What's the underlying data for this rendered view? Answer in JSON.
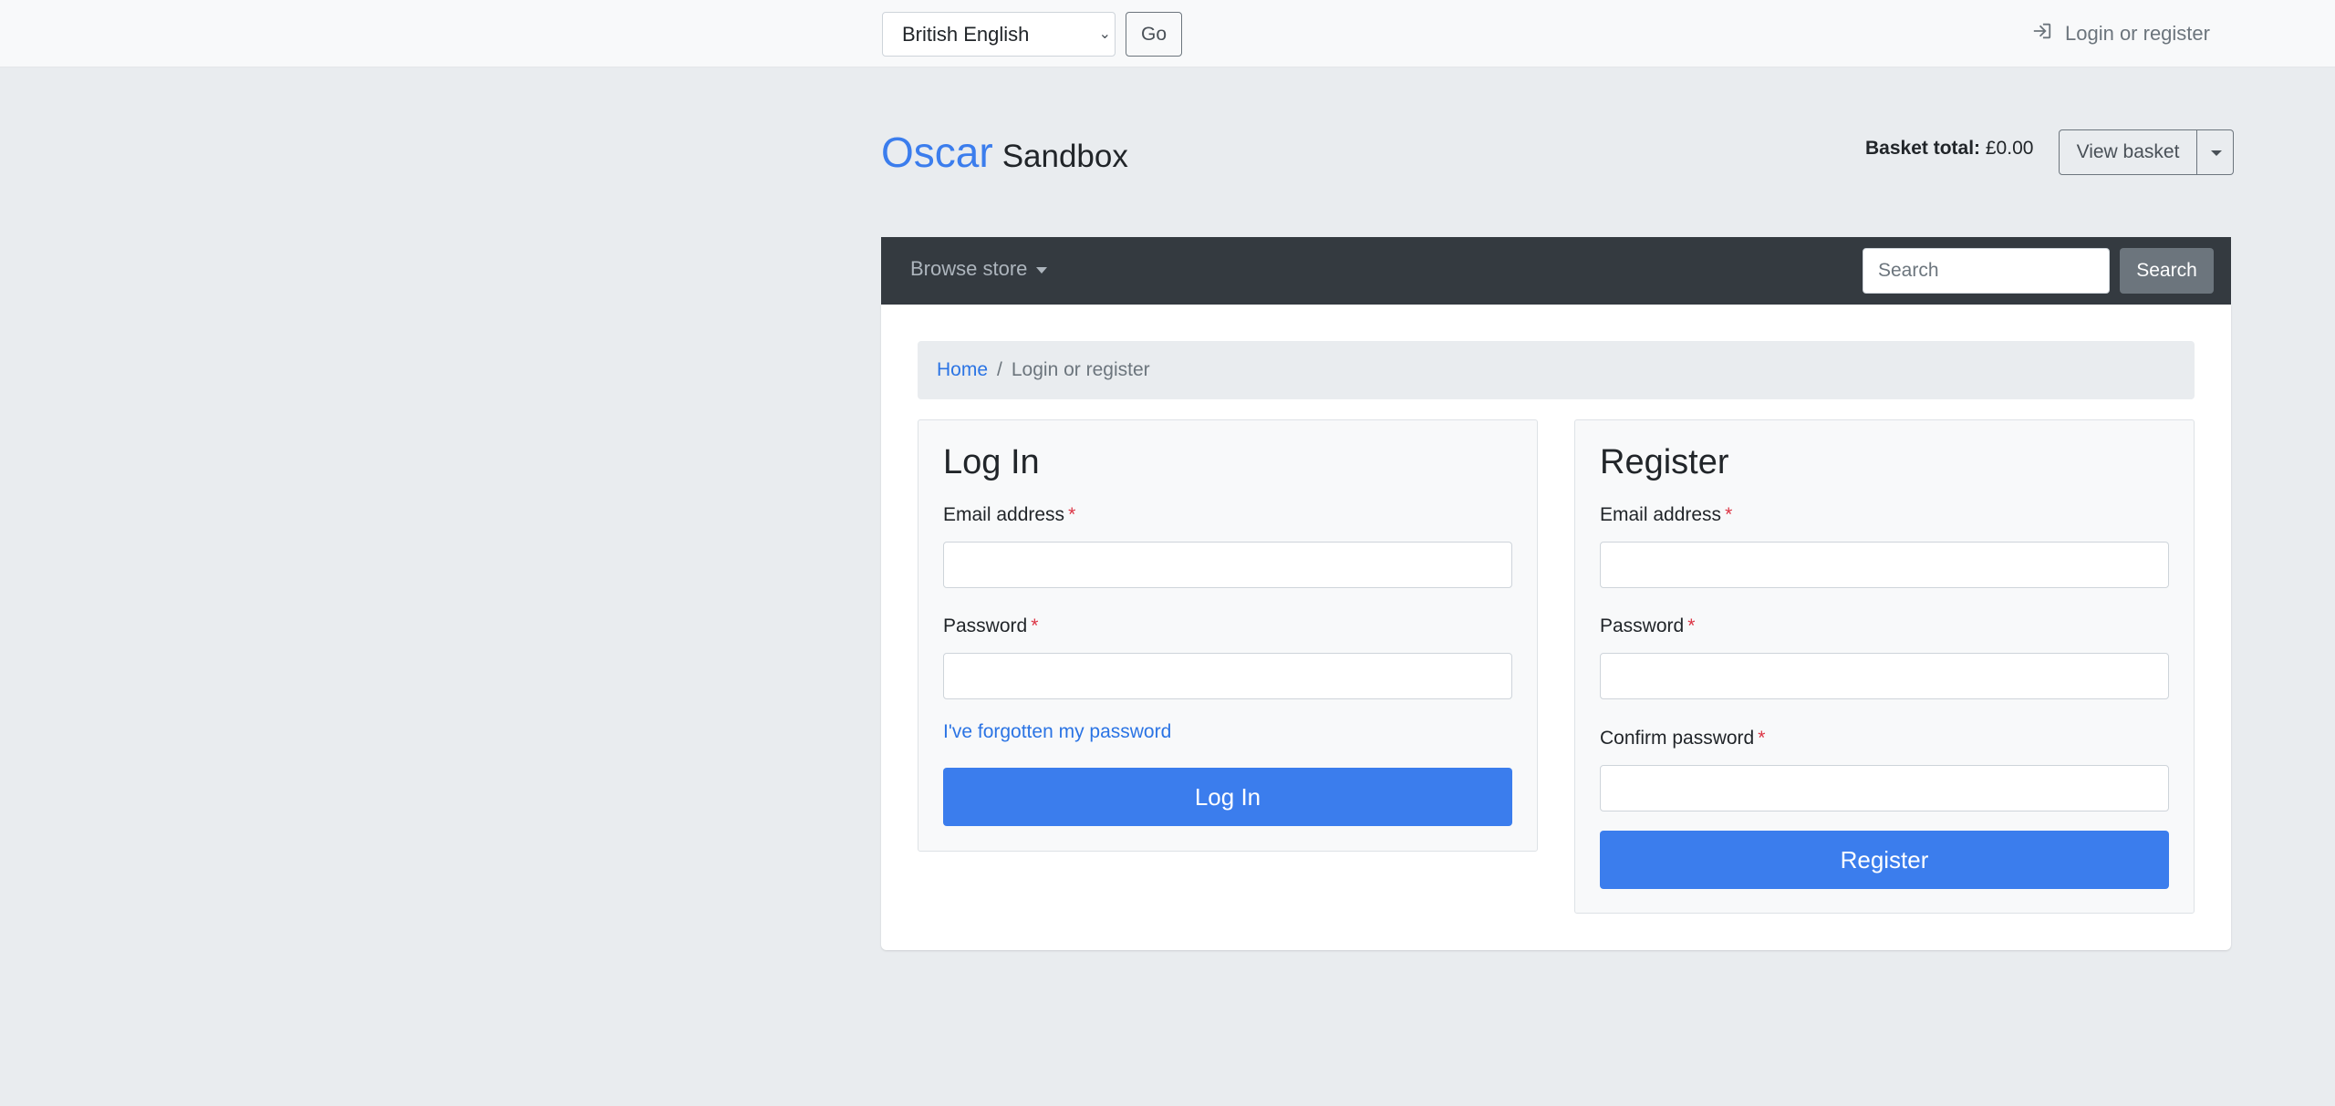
{
  "topbar": {
    "language_selected": "British English",
    "go_label": "Go",
    "login_register_label": "Login or register"
  },
  "header": {
    "brand_primary": "Oscar",
    "brand_secondary": "Sandbox",
    "basket_total_label": "Basket total:",
    "basket_total_value": "£0.00",
    "view_basket_label": "View basket"
  },
  "navbar": {
    "browse_label": "Browse store",
    "search_placeholder": "Search",
    "search_button": "Search"
  },
  "breadcrumb": {
    "home": "Home",
    "separator": "/",
    "current": "Login or register"
  },
  "login": {
    "title": "Log In",
    "email_label": "Email address",
    "password_label": "Password",
    "required_mark": "*",
    "forgot_link": "I've forgotten my password",
    "submit_label": "Log In"
  },
  "register": {
    "title": "Register",
    "email_label": "Email address",
    "password_label": "Password",
    "confirm_label": "Confirm password",
    "required_mark": "*",
    "submit_label": "Register"
  },
  "colors": {
    "accent": "#3b7ded",
    "link": "#2b74e4",
    "navbar": "#343a40",
    "required": "#dc3545"
  }
}
